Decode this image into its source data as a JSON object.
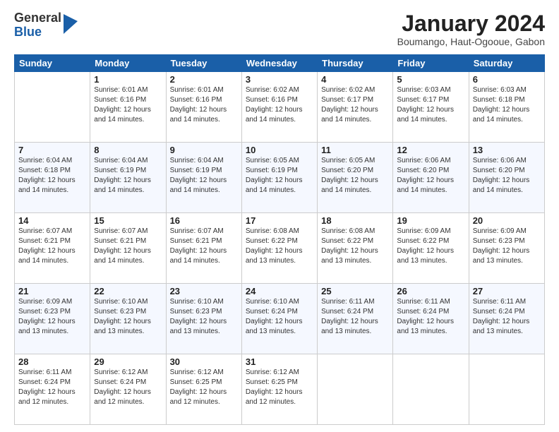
{
  "logo": {
    "general": "General",
    "blue": "Blue"
  },
  "header": {
    "month": "January 2024",
    "location": "Boumango, Haut-Ogooue, Gabon"
  },
  "days_of_week": [
    "Sunday",
    "Monday",
    "Tuesday",
    "Wednesday",
    "Thursday",
    "Friday",
    "Saturday"
  ],
  "weeks": [
    [
      {
        "day": "",
        "info": ""
      },
      {
        "day": "1",
        "info": "Sunrise: 6:01 AM\nSunset: 6:16 PM\nDaylight: 12 hours\nand 14 minutes."
      },
      {
        "day": "2",
        "info": "Sunrise: 6:01 AM\nSunset: 6:16 PM\nDaylight: 12 hours\nand 14 minutes."
      },
      {
        "day": "3",
        "info": "Sunrise: 6:02 AM\nSunset: 6:16 PM\nDaylight: 12 hours\nand 14 minutes."
      },
      {
        "day": "4",
        "info": "Sunrise: 6:02 AM\nSunset: 6:17 PM\nDaylight: 12 hours\nand 14 minutes."
      },
      {
        "day": "5",
        "info": "Sunrise: 6:03 AM\nSunset: 6:17 PM\nDaylight: 12 hours\nand 14 minutes."
      },
      {
        "day": "6",
        "info": "Sunrise: 6:03 AM\nSunset: 6:18 PM\nDaylight: 12 hours\nand 14 minutes."
      }
    ],
    [
      {
        "day": "7",
        "info": "Sunrise: 6:04 AM\nSunset: 6:18 PM\nDaylight: 12 hours\nand 14 minutes."
      },
      {
        "day": "8",
        "info": "Sunrise: 6:04 AM\nSunset: 6:19 PM\nDaylight: 12 hours\nand 14 minutes."
      },
      {
        "day": "9",
        "info": "Sunrise: 6:04 AM\nSunset: 6:19 PM\nDaylight: 12 hours\nand 14 minutes."
      },
      {
        "day": "10",
        "info": "Sunrise: 6:05 AM\nSunset: 6:19 PM\nDaylight: 12 hours\nand 14 minutes."
      },
      {
        "day": "11",
        "info": "Sunrise: 6:05 AM\nSunset: 6:20 PM\nDaylight: 12 hours\nand 14 minutes."
      },
      {
        "day": "12",
        "info": "Sunrise: 6:06 AM\nSunset: 6:20 PM\nDaylight: 12 hours\nand 14 minutes."
      },
      {
        "day": "13",
        "info": "Sunrise: 6:06 AM\nSunset: 6:20 PM\nDaylight: 12 hours\nand 14 minutes."
      }
    ],
    [
      {
        "day": "14",
        "info": "Sunrise: 6:07 AM\nSunset: 6:21 PM\nDaylight: 12 hours\nand 14 minutes."
      },
      {
        "day": "15",
        "info": "Sunrise: 6:07 AM\nSunset: 6:21 PM\nDaylight: 12 hours\nand 14 minutes."
      },
      {
        "day": "16",
        "info": "Sunrise: 6:07 AM\nSunset: 6:21 PM\nDaylight: 12 hours\nand 14 minutes."
      },
      {
        "day": "17",
        "info": "Sunrise: 6:08 AM\nSunset: 6:22 PM\nDaylight: 12 hours\nand 13 minutes."
      },
      {
        "day": "18",
        "info": "Sunrise: 6:08 AM\nSunset: 6:22 PM\nDaylight: 12 hours\nand 13 minutes."
      },
      {
        "day": "19",
        "info": "Sunrise: 6:09 AM\nSunset: 6:22 PM\nDaylight: 12 hours\nand 13 minutes."
      },
      {
        "day": "20",
        "info": "Sunrise: 6:09 AM\nSunset: 6:23 PM\nDaylight: 12 hours\nand 13 minutes."
      }
    ],
    [
      {
        "day": "21",
        "info": "Sunrise: 6:09 AM\nSunset: 6:23 PM\nDaylight: 12 hours\nand 13 minutes."
      },
      {
        "day": "22",
        "info": "Sunrise: 6:10 AM\nSunset: 6:23 PM\nDaylight: 12 hours\nand 13 minutes."
      },
      {
        "day": "23",
        "info": "Sunrise: 6:10 AM\nSunset: 6:23 PM\nDaylight: 12 hours\nand 13 minutes."
      },
      {
        "day": "24",
        "info": "Sunrise: 6:10 AM\nSunset: 6:24 PM\nDaylight: 12 hours\nand 13 minutes."
      },
      {
        "day": "25",
        "info": "Sunrise: 6:11 AM\nSunset: 6:24 PM\nDaylight: 12 hours\nand 13 minutes."
      },
      {
        "day": "26",
        "info": "Sunrise: 6:11 AM\nSunset: 6:24 PM\nDaylight: 12 hours\nand 13 minutes."
      },
      {
        "day": "27",
        "info": "Sunrise: 6:11 AM\nSunset: 6:24 PM\nDaylight: 12 hours\nand 13 minutes."
      }
    ],
    [
      {
        "day": "28",
        "info": "Sunrise: 6:11 AM\nSunset: 6:24 PM\nDaylight: 12 hours\nand 12 minutes."
      },
      {
        "day": "29",
        "info": "Sunrise: 6:12 AM\nSunset: 6:24 PM\nDaylight: 12 hours\nand 12 minutes."
      },
      {
        "day": "30",
        "info": "Sunrise: 6:12 AM\nSunset: 6:25 PM\nDaylight: 12 hours\nand 12 minutes."
      },
      {
        "day": "31",
        "info": "Sunrise: 6:12 AM\nSunset: 6:25 PM\nDaylight: 12 hours\nand 12 minutes."
      },
      {
        "day": "",
        "info": ""
      },
      {
        "day": "",
        "info": ""
      },
      {
        "day": "",
        "info": ""
      }
    ]
  ]
}
